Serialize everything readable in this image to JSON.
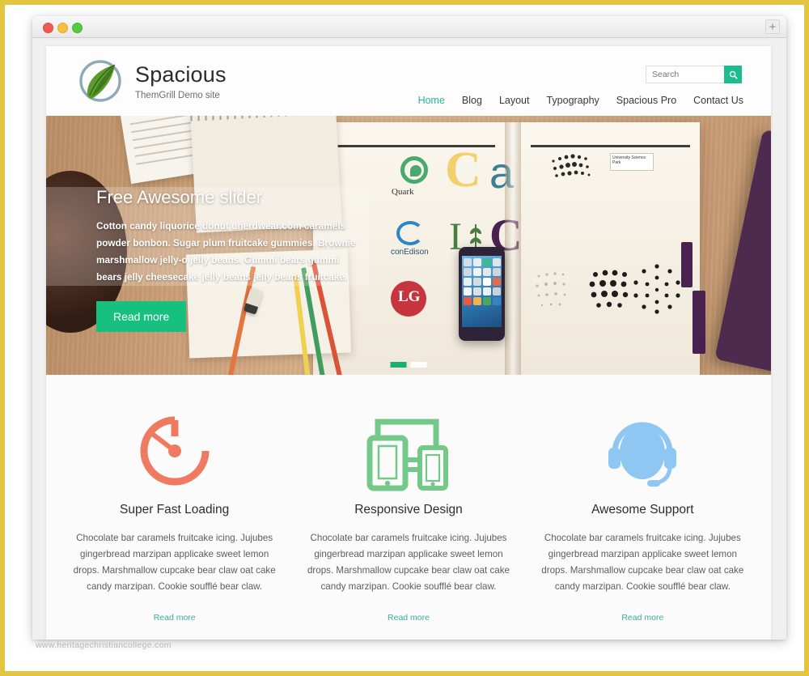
{
  "browser": {
    "traffic_lights": [
      "close",
      "minimize",
      "zoom"
    ],
    "new_tab_label": "+"
  },
  "header": {
    "logo_icon": "leaf-logo-icon",
    "site_title": "Spacious",
    "tagline": "ThemGrill Demo site",
    "search": {
      "placeholder": "Search",
      "value": "",
      "button_icon": "search-icon"
    },
    "nav": [
      {
        "label": "Home",
        "active": true
      },
      {
        "label": "Blog",
        "active": false
      },
      {
        "label": "Layout",
        "active": false
      },
      {
        "label": "Typography",
        "active": false
      },
      {
        "label": "Spacious Pro",
        "active": false
      },
      {
        "label": "Contact Us",
        "active": false
      }
    ]
  },
  "slider": {
    "title": "Free Awesome slider",
    "text": "Cotton candy liquorice donut unerdwear.com caramels powder bonbon. Sugar plum fruitcake gummies. Brownie marshmallow jelly-o jelly beans. Gummi bears gummi bears jelly cheesecake jelly beans jelly beans fruitcake.",
    "button_label": "Read more",
    "dots": [
      {
        "active": true
      },
      {
        "active": false
      }
    ],
    "photo_elements": {
      "logos": [
        "Quark",
        "conEdison",
        "LG"
      ],
      "book_label": "University Science Park"
    }
  },
  "features": [
    {
      "icon": "speedometer-icon",
      "icon_color": "#f07a5f",
      "title": "Super Fast Loading",
      "text": "Chocolate bar caramels fruitcake icing. Jujubes gingerbread marzipan applicake sweet lemon drops. Marshmallow cupcake bear claw oat cake candy marzipan. Cookie soufflé bear claw.",
      "link_label": "Read more"
    },
    {
      "icon": "responsive-devices-icon",
      "icon_color": "#74c98a",
      "title": "Responsive Design",
      "text": "Chocolate bar caramels fruitcake icing. Jujubes gingerbread marzipan applicake sweet lemon drops. Marshmallow cupcake bear claw oat cake candy marzipan. Cookie soufflé bear claw.",
      "link_label": "Read more"
    },
    {
      "icon": "headset-support-icon",
      "icon_color": "#8dc7f2",
      "title": "Awesome Support",
      "text": "Chocolate bar caramels fruitcake icing. Jujubes gingerbread marzipan applicake sweet lemon drops. Marshmallow cupcake bear claw oat cake candy marzipan. Cookie soufflé bear claw.",
      "link_label": "Read more"
    }
  ],
  "watermark": "www.heritagechristiancollege.com",
  "colors": {
    "frame": "#e4c53f",
    "accent_green": "#1bbc8e",
    "nav_active": "#25b79b",
    "slider_button": "#18c07f",
    "link": "#3fae92"
  }
}
